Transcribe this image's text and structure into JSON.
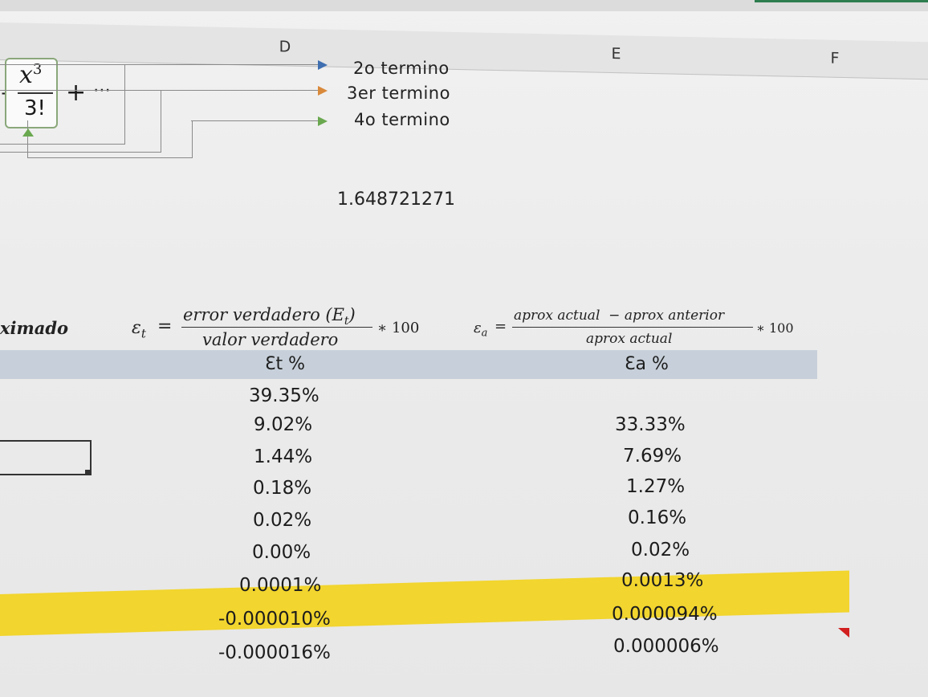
{
  "columns": {
    "d": "D",
    "e": "E",
    "f": "F"
  },
  "formula": {
    "numerator": "x",
    "exponent": "3",
    "denominator": "3!",
    "plus": "+",
    "ellipsis": "⋯",
    "left_plus": "+"
  },
  "terms": {
    "second": "2o termino",
    "third": "3er termino",
    "fourth": "4o termino"
  },
  "true_value": "1.648721271",
  "row_label": "ximado",
  "et_formula": {
    "symbol": "ε",
    "subscript": "t",
    "equals": "=",
    "numerator": "error verdadero (E",
    "numerator_sub": "t",
    "numerator_close": ")",
    "denominator": "valor verdadero",
    "times": "∗ 100"
  },
  "ea_formula": {
    "symbol": "ε",
    "subscript": "a",
    "equals": "=",
    "numerator": "aprox actual  − aprox anterior",
    "denominator": "aprox actual",
    "times": "∗ 100"
  },
  "headers": {
    "et": "Ɛt %",
    "ea": "Ɛa %"
  },
  "et_values": [
    "39.35%",
    "9.02%",
    "1.44%",
    "0.18%",
    "0.02%",
    "0.00%",
    "0.0001%",
    "-0.000010%",
    "-0.000016%"
  ],
  "ea_values": [
    "",
    "33.33%",
    "7.69%",
    "1.27%",
    "0.16%",
    "0.02%",
    "0.0013%",
    "0.000094%",
    "0.000006%"
  ],
  "colors": {
    "highlight": "#f3d31a",
    "header_band": "#c7d0da",
    "arrow_blue": "#3f6fb0",
    "arrow_orange": "#d9893a",
    "arrow_green": "#6aa84f"
  }
}
